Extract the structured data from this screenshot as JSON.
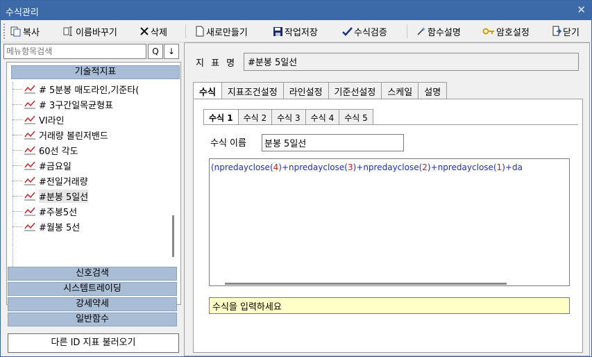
{
  "window": {
    "title": "수식관리",
    "close_glyph": "✕"
  },
  "toolbar": {
    "copy": "복사",
    "rename": "이름바꾸기",
    "delete": "삭제",
    "new": "새로만들기",
    "save": "작업저장",
    "verify": "수식검증",
    "func_help": "함수설명",
    "password": "암호설정",
    "close": "닫기"
  },
  "left": {
    "search_placeholder": "메뉴항목검색",
    "search_button_glyph": "Q",
    "down_button_glyph": "↓",
    "category_header": "기술적지표",
    "tree_items": [
      "# 5분봉 매도라인,기준타(",
      "# 3구간일목균형표",
      "VI라인",
      "거래량 볼린저밴드",
      "60선 각도",
      "#금요일",
      "#전일거래량",
      "#분봉 5일선",
      "#주봉5선",
      "#월봉 5선"
    ],
    "selected_index": 7,
    "categories": [
      "신호검색",
      "시스템트레이딩",
      "강세약세",
      "일반함수"
    ],
    "load_button": "다른 ID 지표 불러오기"
  },
  "right": {
    "indicator_label": "지 표 명",
    "indicator_name": "#분봉 5일선",
    "tabs": [
      "수식",
      "지표조건설정",
      "라인설정",
      "기준선설정",
      "스케일",
      "설명"
    ],
    "active_tab": 0,
    "sub_tabs": [
      "수식 1",
      "수식 2",
      "수식 3",
      "수식 4",
      "수식 5"
    ],
    "active_sub_tab": 0,
    "formula_name_label": "수식 이름",
    "formula_name": "분봉 5일선",
    "formula_parts": [
      {
        "t": "(npredayclose(",
        "c": "fn"
      },
      {
        "t": "4",
        "c": "num"
      },
      {
        "t": ")+npredayclose(",
        "c": "fn"
      },
      {
        "t": "3",
        "c": "num"
      },
      {
        "t": ")+npredayclose(",
        "c": "fn"
      },
      {
        "t": "2",
        "c": "num"
      },
      {
        "t": ")+npredayclose(",
        "c": "fn"
      },
      {
        "t": "1",
        "c": "num"
      },
      {
        "t": ")+da",
        "c": "fn"
      }
    ],
    "message": "수식을 입력하세요"
  },
  "colors": {
    "titlebar": "#3c6aa9",
    "category": "#a9bdd6",
    "formula_fn": "#1a2bd8",
    "formula_num": "#d41b1b",
    "message_bg": "#ffffc8"
  }
}
